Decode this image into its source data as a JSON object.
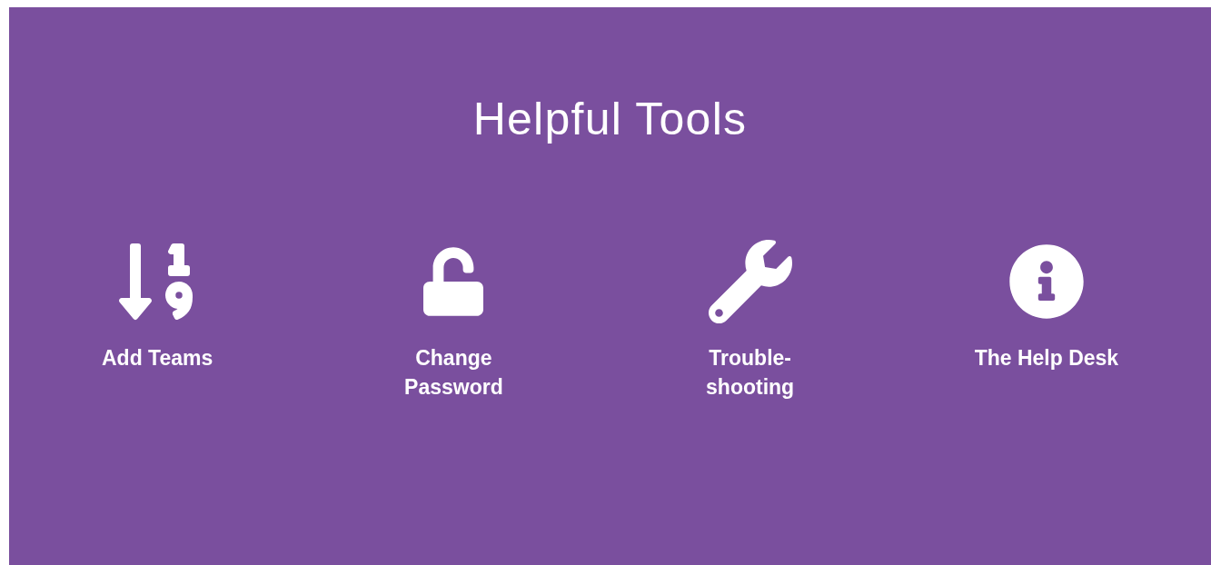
{
  "section": {
    "title": "Helpful Tools"
  },
  "tools": [
    {
      "kind": "sort-numeric",
      "lines": [
        "Add Teams"
      ]
    },
    {
      "kind": "unlock",
      "lines": [
        "Change",
        "Password"
      ]
    },
    {
      "kind": "wrench",
      "lines": [
        "Trouble-",
        "shooting"
      ]
    },
    {
      "kind": "info",
      "lines": [
        "The Help Desk"
      ]
    }
  ]
}
